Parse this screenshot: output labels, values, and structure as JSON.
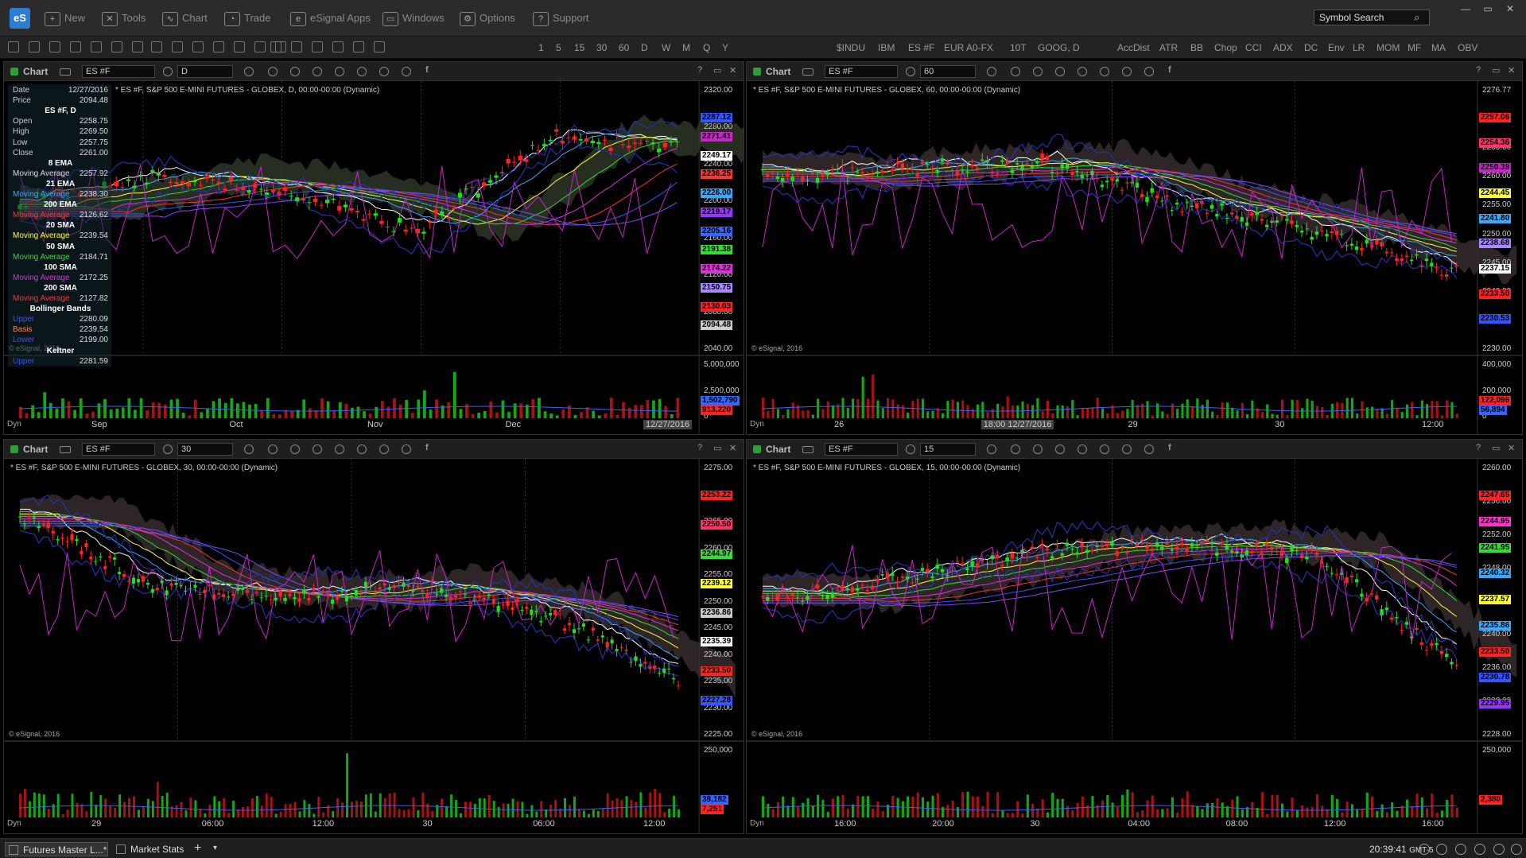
{
  "app": {
    "logo": "eS",
    "menu": [
      "New",
      "Tools",
      "Chart",
      "Trade",
      "eSignal Apps",
      "Windows",
      "Options",
      "Support"
    ],
    "menu_icons": [
      "new-icon",
      "tools-icon",
      "chart-icon",
      "trade-icon",
      "esignal-apps-icon",
      "windows-icon",
      "options-icon",
      "support-icon"
    ],
    "symbol_search_placeholder": "Symbol Search"
  },
  "toolbar": {
    "intervals": [
      "1",
      "5",
      "15",
      "30",
      "60",
      "D",
      "W",
      "M",
      "Q",
      "Y"
    ],
    "symbols": [
      "$INDU",
      "IBM",
      "ES #F",
      "EUR A0-FX",
      "10T",
      "GOOG, D"
    ],
    "studies": [
      "AccDist",
      "ATR",
      "BB",
      "Chop",
      "CCI",
      "ADX",
      "DC",
      "Env",
      "LR",
      "MOM",
      "MF",
      "MA",
      "OBV"
    ]
  },
  "panels": [
    {
      "title": "Chart",
      "symbol": "ES #F",
      "interval": "D",
      "desc": "* ES #F, S&P 500 E-MINI FUTURES - GLOBEX, D, 00:00-00:00 (Dynamic)",
      "copyright": "© eSignal, 2016",
      "axis": [
        "2320.00",
        "2280.00",
        "2240.00",
        "2200.00",
        "2160.00",
        "2120.00",
        "2080.00",
        "2040.00"
      ],
      "tags": [
        {
          "t": "2287.12",
          "c": "#3355ff"
        },
        {
          "t": "2271.41",
          "c": "#cc22cc"
        },
        {
          "t": "2249.17",
          "c": "#ffffff"
        },
        {
          "t": "2236.25",
          "c": "#ff3333"
        },
        {
          "t": "2226.00",
          "c": "#33aaff"
        },
        {
          "t": "2219.17",
          "c": "#9933ff"
        },
        {
          "t": "2205.16",
          "c": "#3366ff"
        },
        {
          "t": "2191.38",
          "c": "#33dd33"
        },
        {
          "t": "2174.22",
          "c": "#dd33dd"
        },
        {
          "t": "2150.75",
          "c": "#aa88ff"
        },
        {
          "t": "2130.03",
          "c": "#ff2222"
        },
        {
          "t": "2094.48",
          "c": "#cccccc"
        }
      ],
      "vol_axis": [
        "5,000,000",
        "2,500,000",
        "0"
      ],
      "vol_tags": [
        {
          "t": "1,502,790",
          "c": "#3366ff"
        },
        {
          "t": "913,220",
          "c": "#ff2222"
        }
      ],
      "dates": [
        "Sep",
        "Oct",
        "Nov",
        "Dec",
        "12/27/2016"
      ],
      "data_window": [
        {
          "l": "Date",
          "v": "12/27/2016",
          "c": "#ccc"
        },
        {
          "l": "Price",
          "v": "2094.48",
          "c": "#ccc"
        },
        {
          "l": "ES #F, D",
          "v": "",
          "c": "#fff",
          "h": true
        },
        {
          "l": "Open",
          "v": "2258.75",
          "c": "#ccc"
        },
        {
          "l": "High",
          "v": "2269.50",
          "c": "#ccc"
        },
        {
          "l": "Low",
          "v": "2257.75",
          "c": "#ccc"
        },
        {
          "l": "Close",
          "v": "2261.00",
          "c": "#ccc"
        },
        {
          "l": "8 EMA",
          "v": "",
          "c": "#fff",
          "h": true
        },
        {
          "l": "Moving Average",
          "v": "2257.92",
          "c": "#ddd"
        },
        {
          "l": "21 EMA",
          "v": "",
          "c": "#fff",
          "h": true
        },
        {
          "l": "Moving Average",
          "v": "2238.30",
          "c": "#33aaff"
        },
        {
          "l": "200 EMA",
          "v": "",
          "c": "#fff",
          "h": true
        },
        {
          "l": "Moving Average",
          "v": "2126.62",
          "c": "#ff3333"
        },
        {
          "l": "20 SMA",
          "v": "",
          "c": "#fff",
          "h": true
        },
        {
          "l": "Moving Average",
          "v": "2239.54",
          "c": "#ffff33"
        },
        {
          "l": "50 SMA",
          "v": "",
          "c": "#fff",
          "h": true
        },
        {
          "l": "Moving Average",
          "v": "2184.71",
          "c": "#33dd33"
        },
        {
          "l": "100 SMA",
          "v": "",
          "c": "#fff",
          "h": true
        },
        {
          "l": "Moving Average",
          "v": "2172.25",
          "c": "#dd33dd"
        },
        {
          "l": "200 SMA",
          "v": "",
          "c": "#fff",
          "h": true
        },
        {
          "l": "Moving Average",
          "v": "2127.82",
          "c": "#ff3333"
        },
        {
          "l": "Bollinger Bands",
          "v": "",
          "c": "#fff",
          "h": true
        },
        {
          "l": "Upper",
          "v": "2280.09",
          "c": "#3355ff"
        },
        {
          "l": "Basis",
          "v": "2239.54",
          "c": "#ff8833"
        },
        {
          "l": "Lower",
          "v": "2199.00",
          "c": "#3355ff"
        },
        {
          "l": "Keltner",
          "v": "",
          "c": "#fff",
          "h": true
        },
        {
          "l": "Upper",
          "v": "2281.59",
          "c": "#3355ff"
        }
      ]
    },
    {
      "title": "Chart",
      "symbol": "ES #F",
      "interval": "60",
      "desc": "* ES #F, S&P 500 E-MINI FUTURES - GLOBEX, 60, 00:00-00:00 (Dynamic)",
      "copyright": "© eSignal, 2016",
      "axis": [
        "2276.77",
        "2270.00",
        "2265.00",
        "2260.00",
        "2255.00",
        "2250.00",
        "2245.00",
        "2240.00",
        "2235.00",
        "2230.00"
      ],
      "tags": [
        {
          "t": "2257.06",
          "c": "#ff2222"
        },
        {
          "t": "2254.36",
          "c": "#ff3366"
        },
        {
          "t": "2250.39",
          "c": "#cc22cc"
        },
        {
          "t": "2244.45",
          "c": "#ffff33"
        },
        {
          "t": "2241.80",
          "c": "#33aaff"
        },
        {
          "t": "2238.68",
          "c": "#aa88ff"
        },
        {
          "t": "2237.15",
          "c": "#ffffff"
        },
        {
          "t": "2233.50",
          "c": "#ff2222"
        },
        {
          "t": "2230.53",
          "c": "#3355ff"
        }
      ],
      "vol_axis": [
        "400,000",
        "200,000",
        "0"
      ],
      "vol_tags": [
        {
          "t": "122,096",
          "c": "#ff2222"
        },
        {
          "t": "56,894",
          "c": "#3366ff"
        }
      ],
      "dates": [
        "26",
        "18:00 12/27/2016",
        "29",
        "30",
        "12:00"
      ]
    },
    {
      "title": "Chart",
      "symbol": "ES #F",
      "interval": "30",
      "desc": "* ES #F, S&P 500 E-MINI FUTURES - GLOBEX, 30, 00:00-00:00 (Dynamic)",
      "copyright": "© eSignal, 2016",
      "axis": [
        "2275.00",
        "2270.00",
        "2265.00",
        "2260.00",
        "2255.00",
        "2250.00",
        "2245.00",
        "2240.00",
        "2235.00",
        "2230.00",
        "2225.00"
      ],
      "tags": [
        {
          "t": "2253.22",
          "c": "#ff2222"
        },
        {
          "t": "2250.50",
          "c": "#ff3366"
        },
        {
          "t": "2244.97",
          "c": "#33dd33"
        },
        {
          "t": "2239.12",
          "c": "#ffff33"
        },
        {
          "t": "2236.86",
          "c": "#cccccc"
        },
        {
          "t": "2235.39",
          "c": "#ffffff"
        },
        {
          "t": "2233.50",
          "c": "#ff2222"
        },
        {
          "t": "2227.28",
          "c": "#3355ff"
        }
      ],
      "vol_axis": [
        "250,000"
      ],
      "vol_tags": [
        {
          "t": "38,182",
          "c": "#3366ff"
        },
        {
          "t": "7,251",
          "c": "#ff2222"
        }
      ],
      "dates": [
        "29",
        "06:00",
        "12:00",
        "30",
        "06:00",
        "12:00"
      ]
    },
    {
      "title": "Chart",
      "symbol": "ES #F",
      "interval": "15",
      "desc": "* ES #F, S&P 500 E-MINI FUTURES - GLOBEX, 15, 00:00-00:00 (Dynamic)",
      "copyright": "© eSignal, 2016",
      "axis": [
        "2260.00",
        "2256.00",
        "2252.00",
        "2248.00",
        "2244.00",
        "2240.00",
        "2236.00",
        "2232.00",
        "2228.00"
      ],
      "tags": [
        {
          "t": "2247.65",
          "c": "#ff2222"
        },
        {
          "t": "2244.95",
          "c": "#ff33cc"
        },
        {
          "t": "2241.95",
          "c": "#33dd33"
        },
        {
          "t": "2240.32",
          "c": "#33aaff"
        },
        {
          "t": "2237.57",
          "c": "#ffff33"
        },
        {
          "t": "2235.86",
          "c": "#33aaff"
        },
        {
          "t": "2233.50",
          "c": "#ff2222"
        },
        {
          "t": "2230.78",
          "c": "#3355ff"
        },
        {
          "t": "2229.95",
          "c": "#9933ff"
        }
      ],
      "vol_axis": [
        "250,000"
      ],
      "vol_tags": [
        {
          "t": "2,380",
          "c": "#ff2222"
        }
      ],
      "dates": [
        "16:00",
        "20:00",
        "30",
        "04:00",
        "08:00",
        "12:00",
        "16:00"
      ]
    }
  ],
  "status": {
    "tabs": [
      "Futures Master L...*",
      "Market Stats"
    ],
    "clock": "20:39:41",
    "tz": "GMT-5",
    "dyn": "Dyn"
  }
}
